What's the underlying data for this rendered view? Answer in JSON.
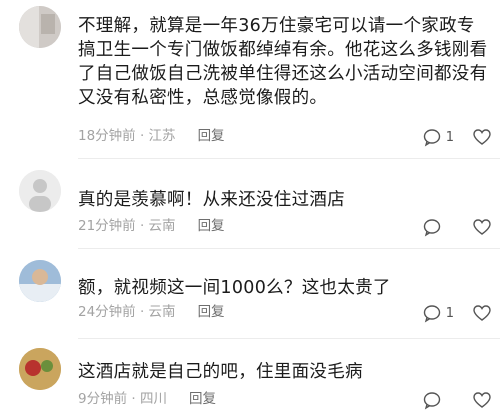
{
  "comments": [
    {
      "text": "不理解，就算是一年36万住豪宅可以请一个家政专搞卫生一个专门做饭都绰绰有余。他花这么多钱刚看了自己做饭自己洗被单住得还这么小活动空间都没有又没有私密性，总感觉像假的。",
      "meta": "18分钟前 · 江苏",
      "reply_label": "回复",
      "likes": "1"
    },
    {
      "text": "真的是羡慕啊！从来还没住过酒店",
      "meta": "21分钟前 · 云南",
      "reply_label": "回复",
      "likes": ""
    },
    {
      "text": "额，就视频这一间1000么？这也太贵了",
      "meta": "24分钟前 · 云南",
      "reply_label": "回复",
      "likes": "1"
    },
    {
      "text": "这酒店就是自己的吧，住里面没毛病",
      "meta": "9分钟前 · 四川",
      "reply_label": "回复",
      "likes": ""
    }
  ]
}
